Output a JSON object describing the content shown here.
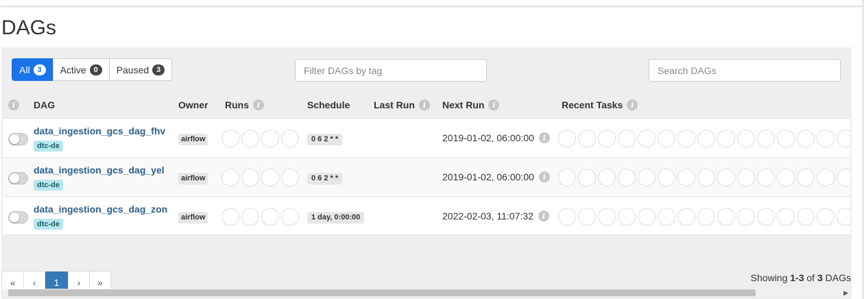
{
  "page": {
    "title": "DAGs"
  },
  "status_filter": [
    {
      "label": "All",
      "count": "3",
      "active": true
    },
    {
      "label": "Active",
      "count": "0",
      "active": false
    },
    {
      "label": "Paused",
      "count": "3",
      "active": false
    }
  ],
  "tag_filter": {
    "placeholder": "Filter DAGs by tag",
    "value": ""
  },
  "search": {
    "placeholder": "Search DAGs",
    "value": ""
  },
  "columns": {
    "dag": "DAG",
    "owner": "Owner",
    "runs": "Runs",
    "schedule": "Schedule",
    "last_run": "Last Run",
    "next_run": "Next Run",
    "recent_tasks": "Recent Tasks"
  },
  "info_icon_glyph": "i",
  "dags": [
    {
      "id": "data_ingestion_gcs_dag_fhv",
      "tag": "dtc-de",
      "owner": "airflow",
      "schedule": "0 6 2 * *",
      "last_run": "",
      "next_run": "2019-01-02, 06:00:00",
      "paused": true
    },
    {
      "id": "data_ingestion_gcs_dag_yel",
      "tag": "dtc-de",
      "owner": "airflow",
      "schedule": "0 6 2 * *",
      "last_run": "",
      "next_run": "2019-01-02, 06:00:00",
      "paused": true
    },
    {
      "id": "data_ingestion_gcs_dag_zon",
      "tag": "dtc-de",
      "owner": "airflow",
      "schedule": "1 day, 0:00:00",
      "last_run": "",
      "next_run": "2022-02-03, 11:07:32",
      "paused": true
    }
  ],
  "pagination": {
    "first": "«",
    "prev": "‹",
    "current": "1",
    "next": "›",
    "last": "»"
  },
  "showing": {
    "prefix": "Showing ",
    "range": "1-3",
    "middle": " of ",
    "total": "3",
    "suffix": " DAGs"
  },
  "colors": {
    "accent": "#1a73e8",
    "link": "#2b5f8a",
    "tag_bg": "#b7e8ee",
    "page_active": "#337ab7"
  }
}
